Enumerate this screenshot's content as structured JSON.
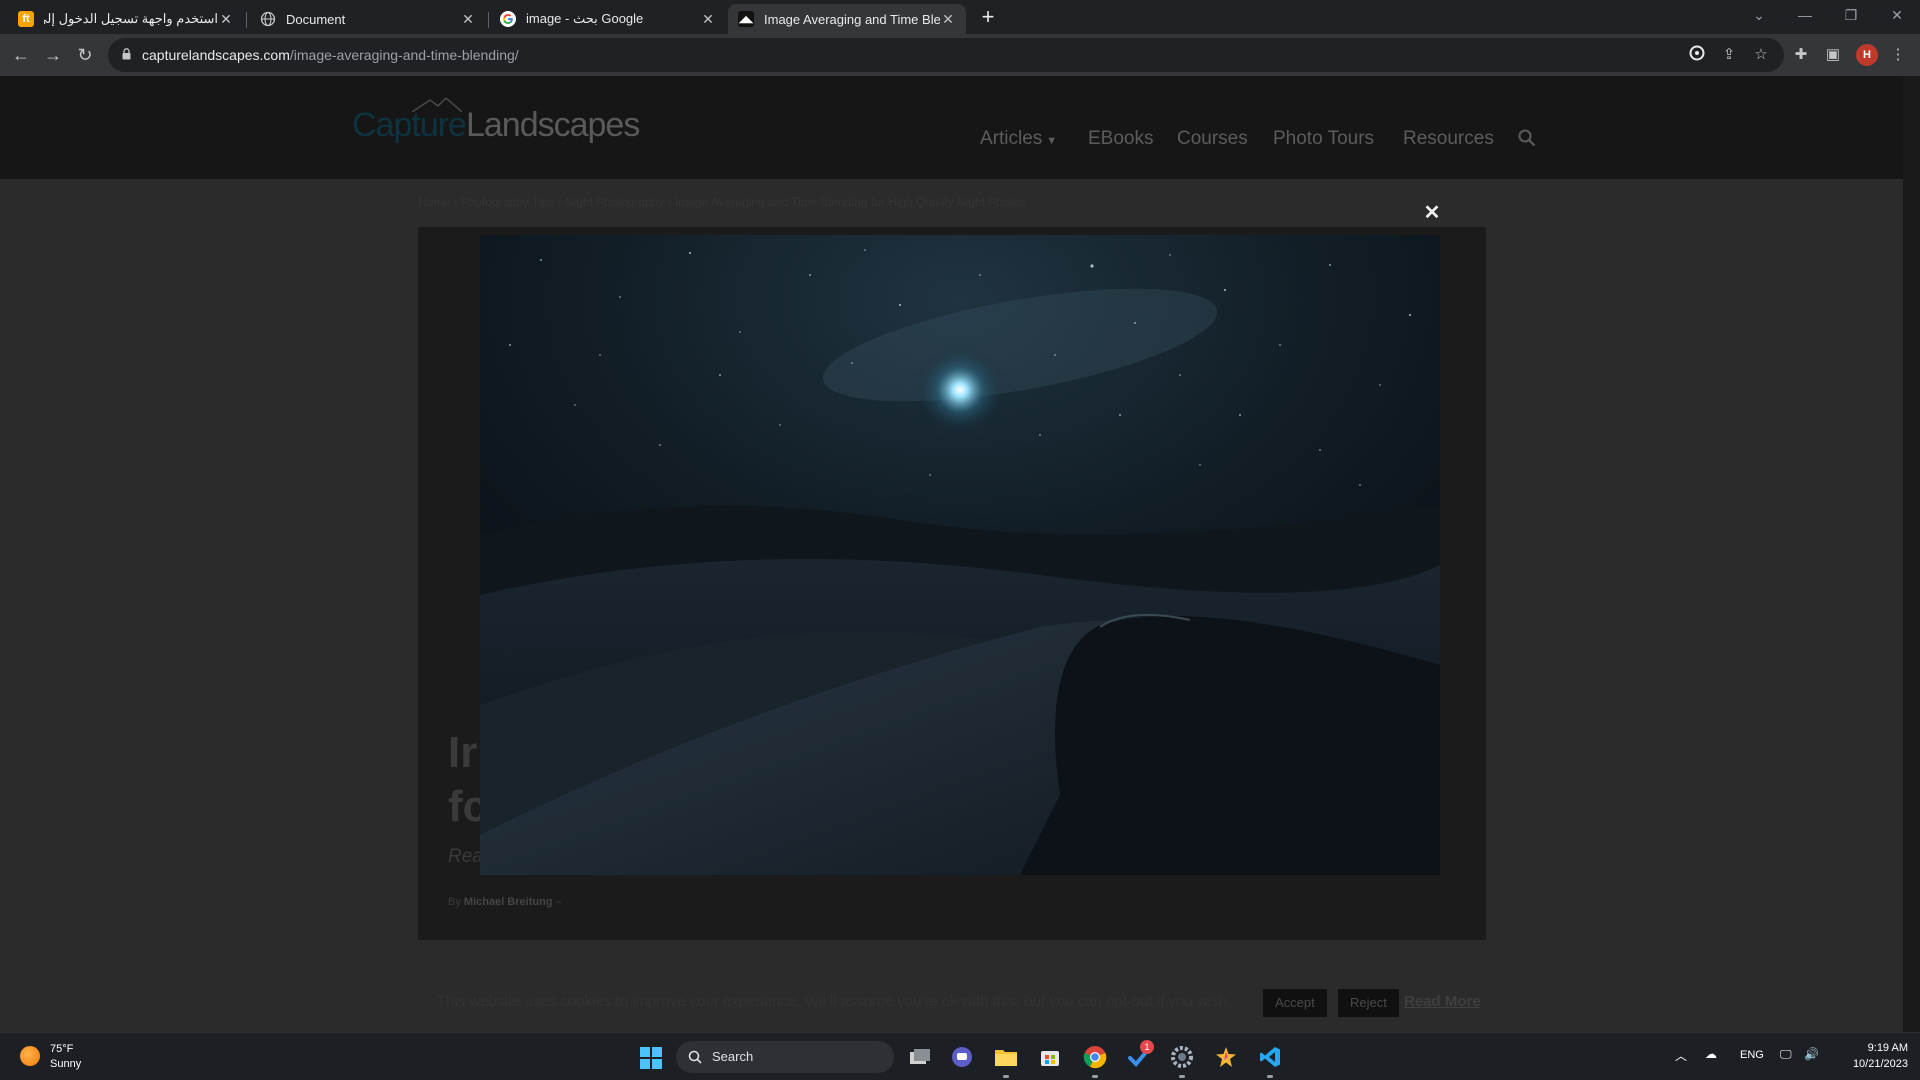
{
  "browser": {
    "tabs": [
      {
        "title": "استخدم واجهة تسجيل الدخول إلى",
        "favicon": "orange-letter-icon",
        "favicon_letter": "ft"
      },
      {
        "title": "Document",
        "favicon": "globe-icon"
      },
      {
        "title": "image - بحث Google",
        "favicon": "google-icon"
      },
      {
        "title": "Image Averaging and Time Blen",
        "favicon": "capture-landscapes-icon"
      }
    ],
    "address": {
      "domain": "capturelandscapes.com",
      "path": "/image-averaging-and-time-blending/"
    },
    "profile_initial": "H"
  },
  "site": {
    "logo": {
      "part1": "Capture",
      "part2": "Landscapes"
    },
    "nav": [
      "Articles",
      "EBooks",
      "Courses",
      "Photo Tours",
      "Resources"
    ]
  },
  "breadcrumb": "Home  ›  Photography Tips  ›  Night Photography  ›  Image Averaging and Time Blending for High Quality Night Photos",
  "article": {
    "title_line1": "Ir",
    "title_line2": "fc",
    "subtitle": "Rea",
    "byline_prefix": "By",
    "author": "Michael Breitung",
    "byline_suffix": "–"
  },
  "lightbox": {
    "close_label": "✕",
    "image_desc_icon": "night-desert-photo"
  },
  "cookie": {
    "text": "This website uses cookies to improve your experience. We'll assume you're ok with this, but you can opt-out if you wish.",
    "accept": "Accept",
    "reject": "Reject",
    "read_more": "Read More"
  },
  "taskbar": {
    "weather_temp": "75°F",
    "weather_cond": "Sunny",
    "search_label": "Search",
    "badge_count": "1",
    "lang": "ENG",
    "time": "9:19 AM",
    "date": "10/21/2023"
  },
  "colors": {
    "accent_blue": "#4cc2ff",
    "profile_red": "#c0392b",
    "page_dim": "#2b2b2b"
  }
}
